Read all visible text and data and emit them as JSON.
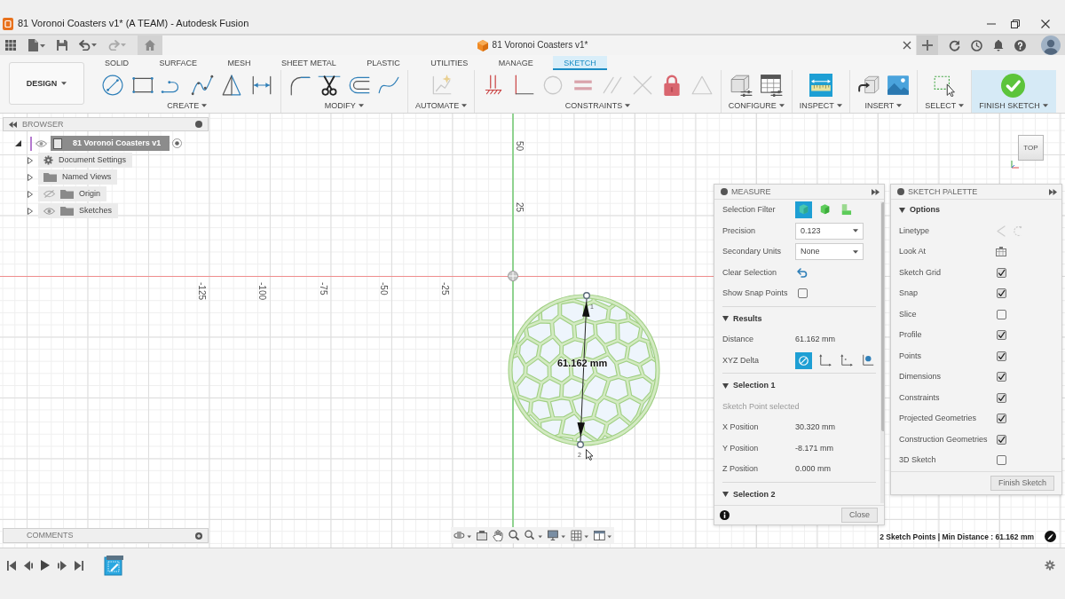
{
  "window": {
    "title": "81 Voronoi Coasters v1* (A TEAM) - Autodesk Fusion"
  },
  "document_tab": {
    "title": "81 Voronoi Coasters v1*"
  },
  "ribbon": {
    "workspace": "DESIGN",
    "tabs": [
      {
        "label": "SOLID",
        "selected": false
      },
      {
        "label": "SURFACE",
        "selected": false
      },
      {
        "label": "MESH",
        "selected": false
      },
      {
        "label": "SHEET METAL",
        "selected": false
      },
      {
        "label": "PLASTIC",
        "selected": false
      },
      {
        "label": "UTILITIES",
        "selected": false
      },
      {
        "label": "MANAGE",
        "selected": false
      },
      {
        "label": "SKETCH",
        "selected": true
      }
    ],
    "groups": [
      {
        "label": "CREATE",
        "kind": "create",
        "highlighted": false
      },
      {
        "label": "MODIFY",
        "kind": "modify",
        "highlighted": false
      },
      {
        "label": "AUTOMATE",
        "kind": "automate",
        "highlighted": false
      },
      {
        "label": "CONSTRAINTS",
        "kind": "constraints",
        "highlighted": false
      },
      {
        "label": "CONFIGURE",
        "kind": "configure",
        "highlighted": false
      },
      {
        "label": "INSPECT",
        "kind": "inspect",
        "highlighted": false
      },
      {
        "label": "INSERT",
        "kind": "insert",
        "highlighted": false
      },
      {
        "label": "SELECT",
        "kind": "select",
        "highlighted": false
      },
      {
        "label": "FINISH SKETCH",
        "kind": "finish",
        "highlighted": true
      }
    ]
  },
  "browser": {
    "title": "BROWSER",
    "items": [
      {
        "label": "81 Voronoi Coasters v1",
        "kind": "document",
        "active": true,
        "expanded": true,
        "visible": true,
        "children": [
          {
            "label": "Document Settings",
            "kind": "settings",
            "active": false,
            "expanded": false
          },
          {
            "label": "Named Views",
            "kind": "folder",
            "active": false,
            "expanded": false
          },
          {
            "label": "Origin",
            "kind": "folder",
            "active": false,
            "expanded": false,
            "visible": false
          },
          {
            "label": "Sketches",
            "kind": "folder",
            "active": false,
            "expanded": false,
            "visible": true
          }
        ]
      }
    ]
  },
  "canvas": {
    "x_axis_labels": [
      "-125",
      "-100",
      "-75",
      "-50",
      "-25"
    ],
    "y_axis_labels": [
      "50",
      "25"
    ],
    "dimension": "61.162 mm",
    "point_labels": [
      "1",
      "2"
    ],
    "view_cube": "TOP"
  },
  "measure": {
    "title": "MEASURE",
    "settings": [
      {
        "kind": "filter",
        "label": "Selection Filter",
        "options": [
          {
            "selected": true
          },
          {
            "selected": false
          },
          {
            "selected": false
          }
        ]
      },
      {
        "kind": "dropdown",
        "label": "Precision",
        "value": "0.123"
      },
      {
        "kind": "dropdown",
        "label": "Secondary Units",
        "value": "None"
      },
      {
        "kind": "action",
        "label": "Clear Selection"
      },
      {
        "kind": "checkbox",
        "label": "Show Snap Points",
        "checked": false
      }
    ],
    "sections": [
      {
        "title": "Results",
        "expanded": true,
        "rows": [
          {
            "kind": "value",
            "label": "Distance",
            "value": "61.162 mm"
          },
          {
            "kind": "delta",
            "label": "XYZ Delta",
            "options": [
              {
                "selected": true
              },
              {
                "selected": false
              },
              {
                "selected": false
              },
              {
                "selected": false
              }
            ]
          }
        ]
      },
      {
        "title": "Selection 1",
        "expanded": true,
        "note": "Sketch Point selected",
        "rows": [
          {
            "kind": "value",
            "label": "X Position",
            "value": "30.320 mm"
          },
          {
            "kind": "value",
            "label": "Y Position",
            "value": "-8.171 mm"
          },
          {
            "kind": "value",
            "label": "Z Position",
            "value": "0.000 mm"
          }
        ]
      },
      {
        "title": "Selection 2",
        "expanded": true
      }
    ],
    "close_button": "Close"
  },
  "sketch_palette": {
    "title": "SKETCH PALETTE",
    "section": {
      "title": "Options",
      "expanded": true
    },
    "rows": [
      {
        "kind": "linetype",
        "label": "Linetype"
      },
      {
        "kind": "look_at",
        "label": "Look At"
      },
      {
        "kind": "checkbox",
        "label": "Sketch Grid",
        "checked": true
      },
      {
        "kind": "checkbox",
        "label": "Snap",
        "checked": true
      },
      {
        "kind": "checkbox",
        "label": "Slice",
        "checked": false
      },
      {
        "kind": "checkbox",
        "label": "Profile",
        "checked": true
      },
      {
        "kind": "checkbox",
        "label": "Points",
        "checked": true
      },
      {
        "kind": "checkbox",
        "label": "Dimensions",
        "checked": true
      },
      {
        "kind": "checkbox",
        "label": "Constraints",
        "checked": true
      },
      {
        "kind": "checkbox",
        "label": "Projected Geometries",
        "checked": true
      },
      {
        "kind": "checkbox",
        "label": "Construction Geometries",
        "checked": true
      },
      {
        "kind": "checkbox",
        "label": "3D Sketch",
        "checked": false
      }
    ],
    "finish_button": "Finish Sketch"
  },
  "comments": {
    "title": "COMMENTS"
  },
  "status_bar": {
    "text": "2 Sketch Points | Min Distance : 61.162 mm"
  }
}
